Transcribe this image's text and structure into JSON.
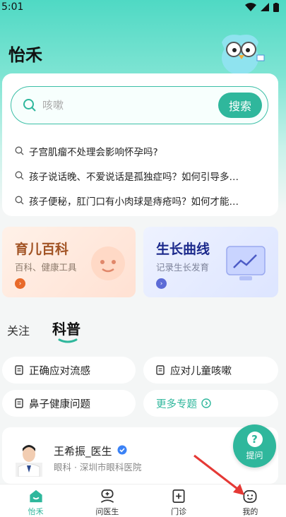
{
  "status_bar": {
    "time": "5:01"
  },
  "app": {
    "title": "怡禾"
  },
  "search": {
    "placeholder": "咳嗽",
    "button_label": "搜索",
    "suggestions": [
      "子宫肌瘤不处理会影响怀孕吗?",
      "孩子说话晚、不爱说话是孤独症吗？如何引导多…",
      "孩子便秘，肛门口有小肉球是痔疮吗？如何才能…"
    ]
  },
  "tools": [
    {
      "title": "育儿百科",
      "subtitle": "百科、健康工具",
      "title_color": "#a25425",
      "arrow_color": "#e86a2a"
    },
    {
      "title": "生长曲线",
      "subtitle": "记录生长发育",
      "title_color": "#1c2a8c",
      "arrow_color": "#5c6bd6"
    }
  ],
  "tabs": {
    "follow": "关注",
    "science": "科普"
  },
  "topics": [
    "正确应对流感",
    "应对儿童咳嗽",
    "鼻子健康问题",
    "更多专题"
  ],
  "doctor": {
    "name": "王希振_医生",
    "meta": "眼科 · 深圳市眼科医院"
  },
  "fab": {
    "label": "提问"
  },
  "nav": [
    {
      "label": "怡禾",
      "icon": "home-icon",
      "active": true
    },
    {
      "label": "问医生",
      "icon": "doctor-icon",
      "active": false
    },
    {
      "label": "门诊",
      "icon": "clinic-icon",
      "active": false
    },
    {
      "label": "我的",
      "icon": "profile-icon",
      "active": false
    }
  ],
  "colors": {
    "accent": "#2fb79c",
    "annotation_arrow": "#e53935"
  }
}
